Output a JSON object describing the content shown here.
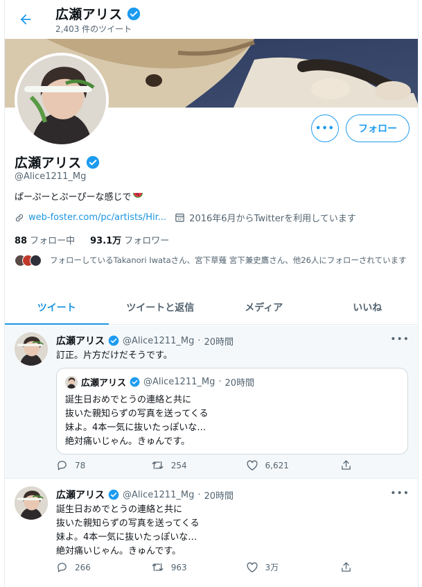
{
  "header": {
    "name": "広瀬アリス",
    "tweet_count": "2,403 件のツイート"
  },
  "profile": {
    "name": "広瀬アリス",
    "handle": "@Alice1211_Mg",
    "bio": "ぱーぷーとぷーぴーな感じで",
    "link": "web-foster.com/pc/artists/Hir...",
    "joined": "2016年6月からTwitterを利用しています",
    "following_count": "88",
    "following_label": "フォロー中",
    "followers_count": "93.1万",
    "followers_label": "フォロワー",
    "followed_by": "フォローしているTakanori Iwataさん、宮下草薙 宮下兼史鷹さん、他26人にフォローされています",
    "more_label": "•••",
    "follow_label": "フォロー"
  },
  "tabs": [
    "ツイート",
    "ツイートと返信",
    "メディア",
    "いいね"
  ],
  "tweets": [
    {
      "name": "広瀬アリス",
      "handle": "@Alice1211_Mg",
      "time": "20時間",
      "text": "訂正。片方だけだそうです。",
      "quote": {
        "name": "広瀬アリス",
        "handle": "@Alice1211_Mg",
        "time": "20時間",
        "text": "誕生日おめでとうの連絡と共に\n抜いた親知らずの写真を送ってくる\n妹よ。4本一気に抜いたっぽいな…\n絶対痛いじゃん。きゅんです。"
      },
      "replies": "78",
      "retweets": "254",
      "likes": "6,621"
    },
    {
      "name": "広瀬アリス",
      "handle": "@Alice1211_Mg",
      "time": "20時間",
      "text": "誕生日おめでとうの連絡と共に\n抜いた親知らずの写真を送ってくる\n妹よ。4本一気に抜いたっぽいな…\n絶対痛いじゃん。きゅんです。",
      "replies": "266",
      "retweets": "963",
      "likes": "3万"
    }
  ],
  "separator": "·",
  "colors": {
    "accent": "#1b95e0",
    "verified": "#1d9bf0",
    "muted": "#536471"
  }
}
